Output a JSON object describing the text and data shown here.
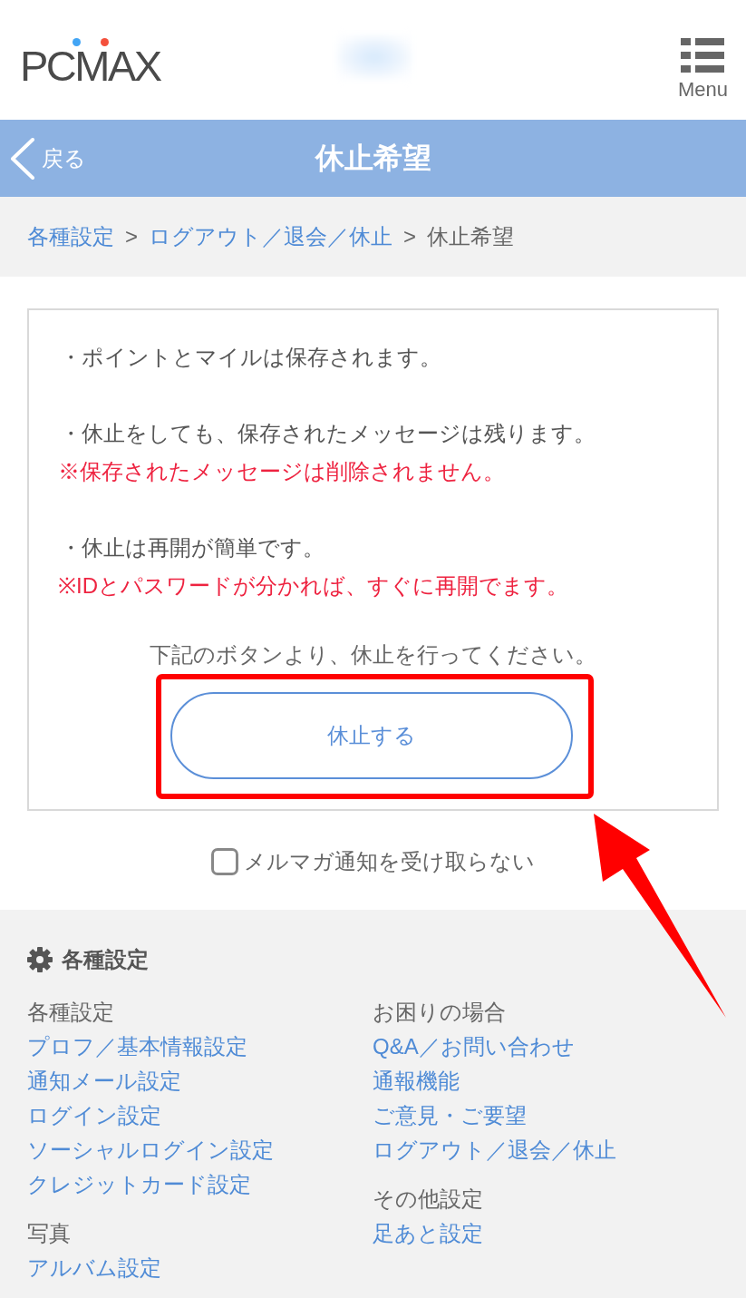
{
  "header": {
    "logo": "PCMAX",
    "menu_label": "Menu"
  },
  "title_bar": {
    "back_label": "戻る",
    "title": "休止希望"
  },
  "breadcrumb": {
    "items": [
      {
        "label": "各種設定",
        "link": true
      },
      {
        "label": "ログアウト／退会／休止",
        "link": true
      },
      {
        "label": "休止希望",
        "link": false
      }
    ],
    "separators": [
      ">",
      ">"
    ]
  },
  "notice": {
    "items": [
      {
        "text": "・ポイントとマイルは保存されます。"
      },
      {
        "text": "・休止をしても、保存されたメッセージは残ります。",
        "note": "※保存されたメッセージは削除されません。"
      },
      {
        "text": "・休止は再開が簡単です。",
        "note": "※IDとパスワードが分かれば、すぐに再開でます。"
      }
    ],
    "instruction": "下記のボタンより、休止を行ってください。",
    "button": "休止する"
  },
  "newsletter_opt_out": {
    "label": "メルマガ通知を受け取らない",
    "checked": false
  },
  "settings_menu": {
    "title": "各種設定",
    "columns": [
      [
        {
          "heading": "各種設定",
          "links": [
            "プロフ／基本情報設定",
            "通知メール設定",
            "ログイン設定",
            "ソーシャルログイン設定",
            "クレジットカード設定"
          ]
        },
        {
          "heading": "写真",
          "links": [
            "アルバム設定"
          ]
        }
      ],
      [
        {
          "heading": "お困りの場合",
          "links": [
            "Q&A／お問い合わせ",
            "通報機能",
            "ご意見・ご要望",
            "ログアウト／退会／休止"
          ]
        },
        {
          "heading": "その他設定",
          "links": [
            "足あと設定"
          ]
        }
      ]
    ]
  },
  "annotations": {
    "frame": true,
    "arrow": true
  }
}
